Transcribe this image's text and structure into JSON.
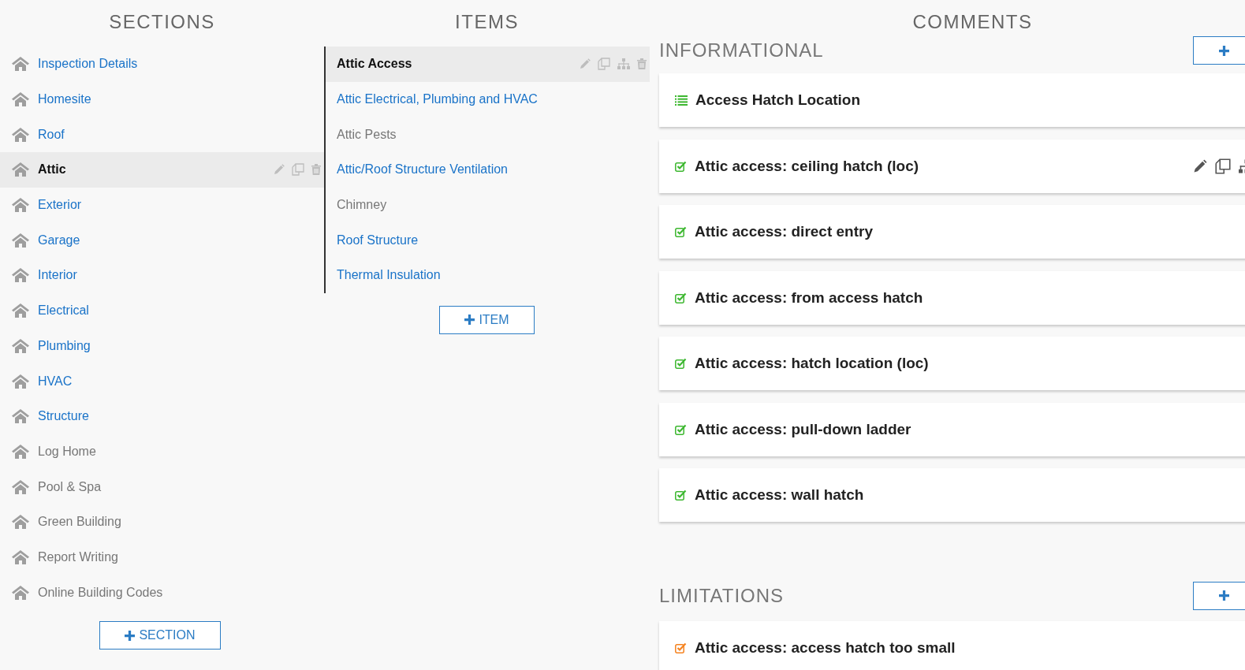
{
  "sections": {
    "title": "SECTIONS",
    "items": [
      {
        "label": "Inspection Details",
        "populated": true,
        "selected": false
      },
      {
        "label": "Homesite",
        "populated": true,
        "selected": false
      },
      {
        "label": "Roof",
        "populated": true,
        "selected": false
      },
      {
        "label": "Attic",
        "populated": true,
        "selected": true
      },
      {
        "label": "Exterior",
        "populated": true,
        "selected": false
      },
      {
        "label": "Garage",
        "populated": true,
        "selected": false
      },
      {
        "label": "Interior",
        "populated": true,
        "selected": false
      },
      {
        "label": "Electrical",
        "populated": true,
        "selected": false
      },
      {
        "label": "Plumbing",
        "populated": true,
        "selected": false
      },
      {
        "label": "HVAC",
        "populated": true,
        "selected": false
      },
      {
        "label": "Structure",
        "populated": true,
        "selected": false
      },
      {
        "label": "Log Home",
        "populated": false,
        "selected": false
      },
      {
        "label": "Pool & Spa",
        "populated": false,
        "selected": false
      },
      {
        "label": "Green Building",
        "populated": false,
        "selected": false
      },
      {
        "label": "Report Writing",
        "populated": false,
        "selected": false
      },
      {
        "label": "Online Building Codes",
        "populated": false,
        "selected": false
      }
    ],
    "add_button": "SECTION"
  },
  "items": {
    "title": "ITEMS",
    "items": [
      {
        "label": "Attic Access",
        "populated": true,
        "selected": true
      },
      {
        "label": "Attic Electrical, Plumbing and HVAC",
        "populated": true,
        "selected": false
      },
      {
        "label": "Attic Pests",
        "populated": false,
        "selected": false
      },
      {
        "label": "Attic/Roof Structure Ventilation",
        "populated": true,
        "selected": false
      },
      {
        "label": "Chimney",
        "populated": false,
        "selected": false
      },
      {
        "label": "Roof Structure",
        "populated": true,
        "selected": false
      },
      {
        "label": "Thermal Insulation",
        "populated": true,
        "selected": false
      }
    ],
    "add_button": "ITEM"
  },
  "comments": {
    "title": "COMMENTS",
    "groups": [
      {
        "title": "INFORMATIONAL",
        "cards": [
          {
            "label": "Access Hatch Location",
            "kind": "list",
            "color": "#3cb72f",
            "hovered": false
          },
          {
            "label": "Attic access: ceiling hatch (loc)",
            "kind": "checkbox",
            "color": "#3cb72f",
            "hovered": true
          },
          {
            "label": "Attic access: direct entry",
            "kind": "checkbox",
            "color": "#3cb72f",
            "hovered": false
          },
          {
            "label": "Attic access: from access hatch",
            "kind": "checkbox",
            "color": "#3cb72f",
            "hovered": false
          },
          {
            "label": "Attic access: hatch location (loc)",
            "kind": "checkbox",
            "color": "#3cb72f",
            "hovered": false
          },
          {
            "label": "Attic access: pull-down ladder",
            "kind": "checkbox",
            "color": "#3cb72f",
            "hovered": false
          },
          {
            "label": "Attic access: wall hatch",
            "kind": "checkbox",
            "color": "#3cb72f",
            "hovered": false
          }
        ]
      },
      {
        "title": "LIMITATIONS",
        "cards": [
          {
            "label": "Attic access: access hatch too small",
            "kind": "checkbox",
            "color": "#f5821f",
            "hovered": false
          }
        ]
      }
    ]
  }
}
